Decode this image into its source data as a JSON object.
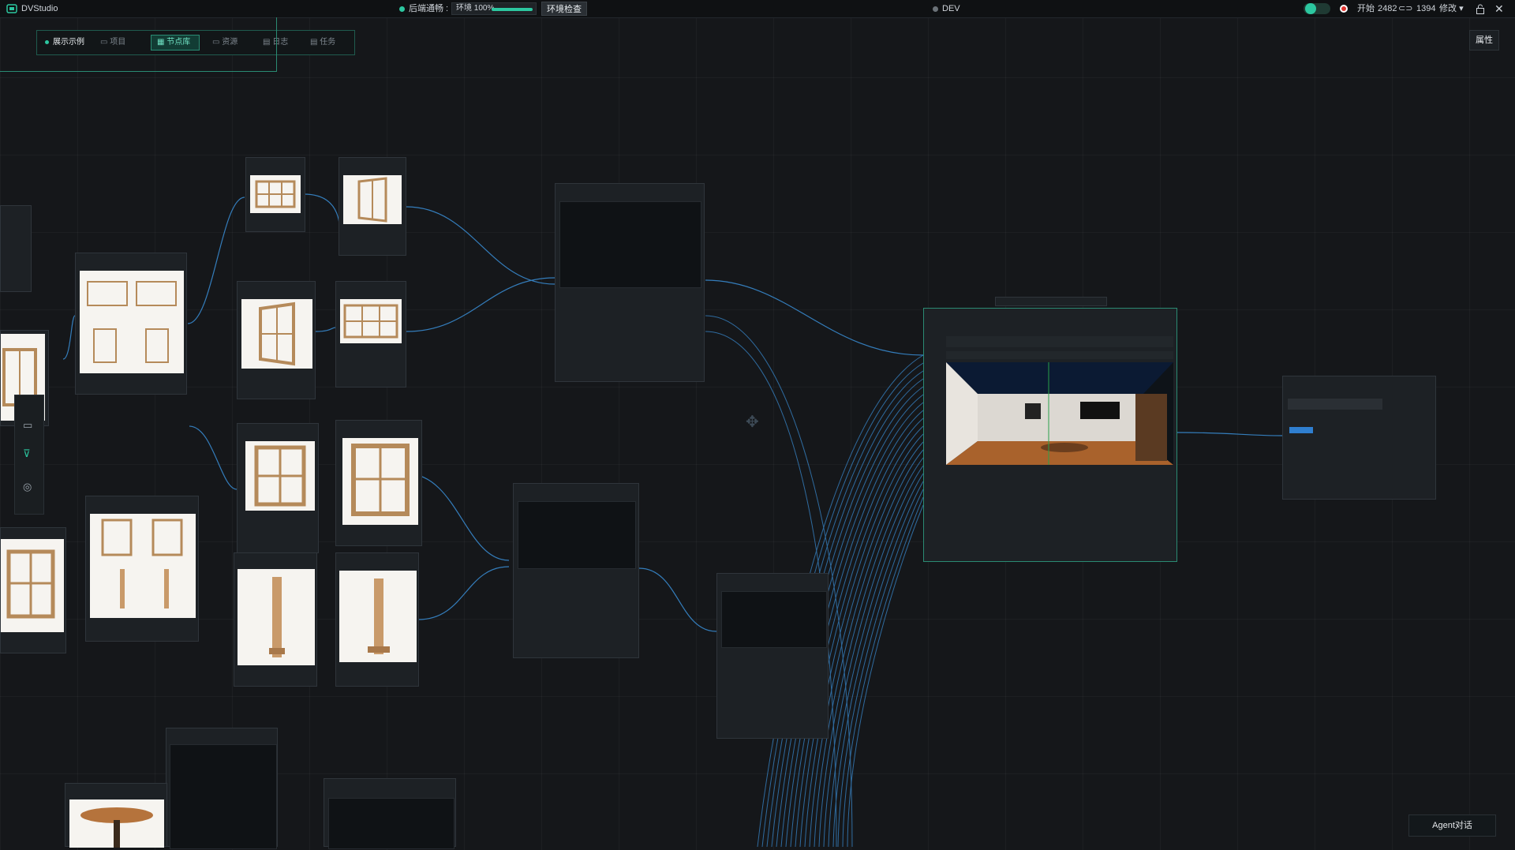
{
  "app": {
    "title": "DVStudio"
  },
  "top": {
    "backend_status": "后端通畅 :",
    "env_progress": {
      "label": "环境 100%",
      "fraction": 1.0
    },
    "env_check_button": "环境检查",
    "mode": "DEV",
    "start_label": "开始",
    "width": "2482",
    "height": "1394",
    "edit_menu": "修改"
  },
  "toolbar": {
    "items": [
      {
        "label": "展示示例"
      },
      {
        "label": "项目"
      },
      {
        "label": "节点库"
      },
      {
        "label": "资源"
      },
      {
        "label": "日志"
      },
      {
        "label": "任务"
      }
    ]
  },
  "right": {
    "properties_button": "属性"
  },
  "bottom": {
    "agent_button": "Agent对话"
  },
  "colors": {
    "accent": "#2cc7a0",
    "wire": "#3a8fd8",
    "panel": "#1d2125"
  }
}
